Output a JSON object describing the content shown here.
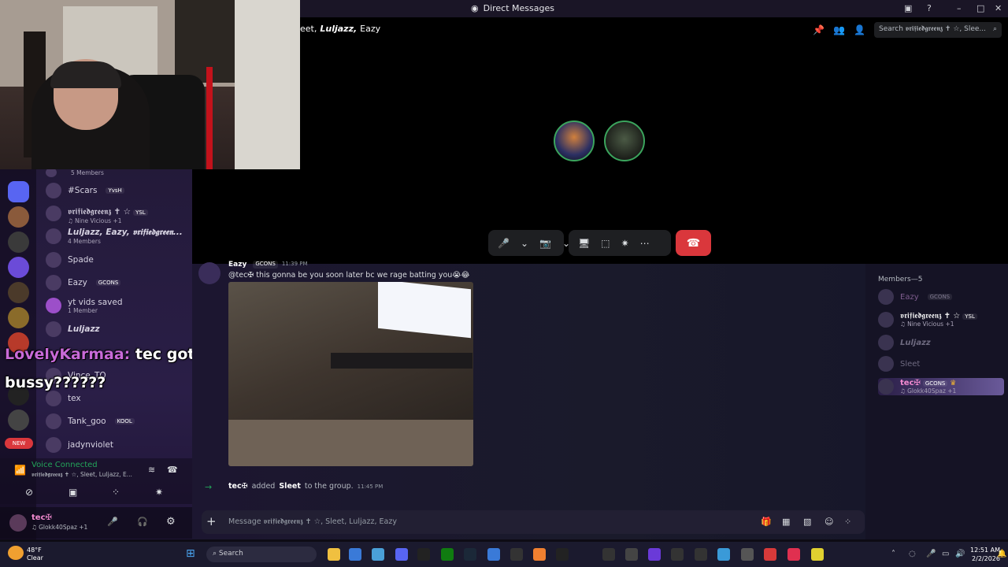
{
  "window": {
    "title": "Direct Messages",
    "icons": [
      "inbox-icon",
      "help-icon",
      "minimize-icon",
      "maximize-icon",
      "close-icon"
    ]
  },
  "call": {
    "header_prefix": "eet,",
    "header_names": [
      "Luljazz,",
      "Eazy"
    ],
    "search_placeholder": "Search 𝖛𝖗𝖎𝖋𝖎𝖊𝖉𝖌𝖗𝖊𝖊𝖓𝖟 ✝ ☆, Slee...",
    "controls": {
      "mic": "🎤",
      "camera": "📷",
      "screen": "🖥",
      "activities": "⬚",
      "soundboard": "✷",
      "more": "⋯",
      "end": "☎"
    }
  },
  "sidebar": {
    "top_item_sub": "5 Members",
    "items": [
      {
        "name": "#Scars",
        "tag": "YvsH",
        "sub": ""
      },
      {
        "name": "𝖛𝖗𝖎𝖋𝖎𝖊𝖉𝖌𝖗𝖊𝖊𝖓𝖟 ✝ ☆",
        "tag": "YSL",
        "sub": "♫ Nine Vicious +1"
      },
      {
        "name": "Luljazz, Eazy, 𝖛𝖗𝖎𝖋𝖎𝖊𝖉𝖌𝖗𝖊𝖊𝖓...",
        "tag": "",
        "sub": "4 Members"
      },
      {
        "name": "Spade",
        "tag": "",
        "sub": ""
      },
      {
        "name": "Eazy",
        "tag": "GCONS",
        "sub": ""
      },
      {
        "name": "yt vids saved",
        "tag": "",
        "sub": "1 Member"
      },
      {
        "name": "Luljazz",
        "tag": "",
        "sub": ""
      },
      {
        "name": "Vince_TQ",
        "tag": "",
        "sub": ""
      },
      {
        "name": "tex",
        "tag": "",
        "sub": ""
      },
      {
        "name": "Tank_goo",
        "tag": "KOOL",
        "sub": ""
      },
      {
        "name": "jadynviolet",
        "tag": "",
        "sub": ""
      }
    ],
    "new_badge": "NEW"
  },
  "overlay": {
    "name": "LovelyKarmaa:",
    "message": "tec got a bussy??????"
  },
  "voice": {
    "status": "Voice Connected",
    "channel": "𝖛𝖗𝖎𝖋𝖎𝖊𝖉𝖌𝖗𝖊𝖊𝖓𝖟 ✝ ☆, Sleet, Luljazz, E..."
  },
  "user": {
    "name": "tec✠",
    "status": "♫ Glokk40Spaz +1"
  },
  "chat": {
    "message_author": "Eazy",
    "message_tag": "GCONS",
    "message_time": "11:39 PM",
    "message_text": "@tec✠  this gonna be you soon later bc we rage batting you😭😂",
    "system_actor": "tec✠",
    "system_action": "added",
    "system_target": "Sleet",
    "system_suffix": "to the group.",
    "system_time": "11:45 PM",
    "composer_placeholder": "Message 𝖛𝖗𝖎𝖋𝖎𝖊𝖉𝖌𝖗𝖊𝖊𝖓𝖟 ✝ ☆, Sleet, Luljazz, Eazy"
  },
  "members": {
    "header": "Members—5",
    "list": [
      {
        "name": "Eazy",
        "tag": "GCONS",
        "sub": ""
      },
      {
        "name": "𝖛𝖗𝖎𝖋𝖎𝖊𝖉𝖌𝖗𝖊𝖊𝖓𝖟 ✝ ☆",
        "tag": "YSL",
        "sub": "♫ Nine Vicious +1"
      },
      {
        "name": "Luljazz",
        "tag": "",
        "sub": ""
      },
      {
        "name": "Sleet",
        "tag": "",
        "sub": ""
      },
      {
        "name": "tec✠",
        "tag": "GCONS",
        "sub": "♫ Glokk40Spaz +1"
      }
    ]
  },
  "taskbar": {
    "weather_temp": "48°F",
    "weather_desc": "Clear",
    "search": "Search",
    "time": "12:51 AM",
    "date": "2/2/2026"
  },
  "colors": {
    "accent_red": "#da373c",
    "online_green": "#3ba55d",
    "purple_panel": "#2a1e47"
  }
}
